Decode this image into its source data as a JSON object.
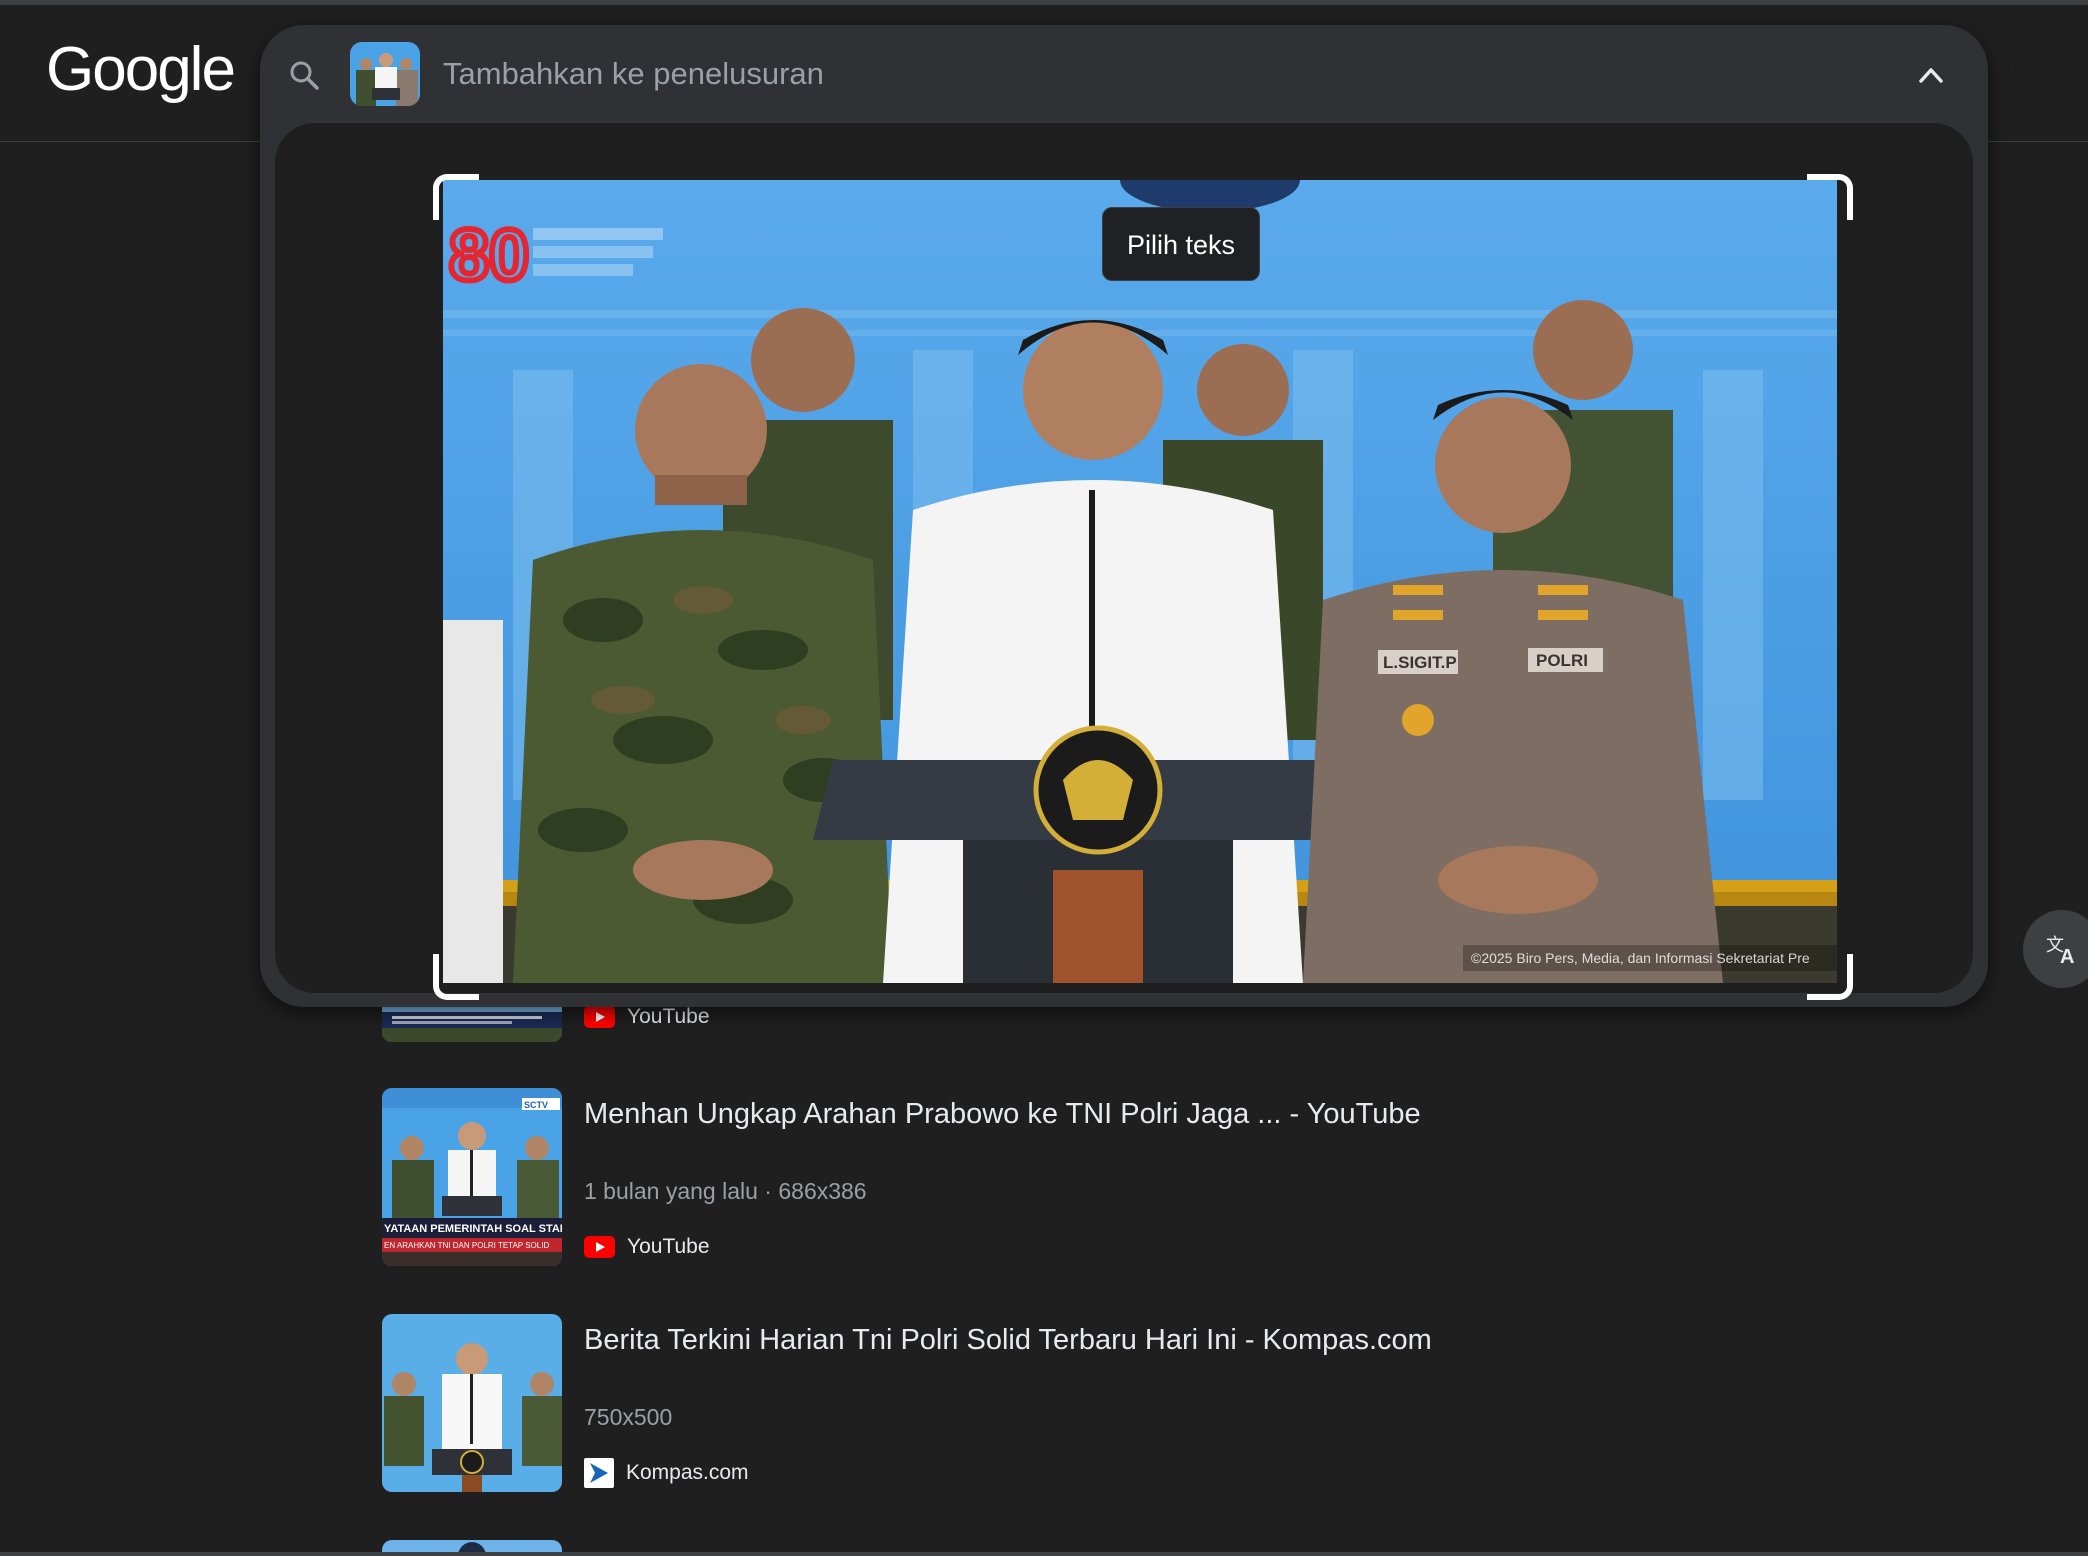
{
  "brand": {
    "logo_text": "Google"
  },
  "search": {
    "placeholder": "Tambahkan ke penelusuran",
    "value": ""
  },
  "lens": {
    "tooltip": "Pilih teks",
    "translate_icon": "translate-icon",
    "expand_icon": "expand-icon",
    "collapse_icon": "chevron-up-icon"
  },
  "results": [
    {
      "source": "YouTube",
      "source_icon": "youtube-icon"
    },
    {
      "title": "Menhan Ungkap Arahan Prabowo ke TNI Polri Jaga ... - YouTube",
      "meta": "1 bulan yang lalu · 686x386",
      "source": "YouTube",
      "source_icon": "youtube-icon"
    },
    {
      "title": "Berita Terkini Harian Tni Polri Solid Terbaru Hari Ini - Kompas.com",
      "meta": "750x500",
      "source": "Kompas.com",
      "source_icon": "kompas-icon"
    }
  ],
  "colors": {
    "background": "#1f1f1f",
    "panel": "#303134",
    "youtube_red": "#ff0000",
    "sky_blue": "#4aa3e6"
  }
}
